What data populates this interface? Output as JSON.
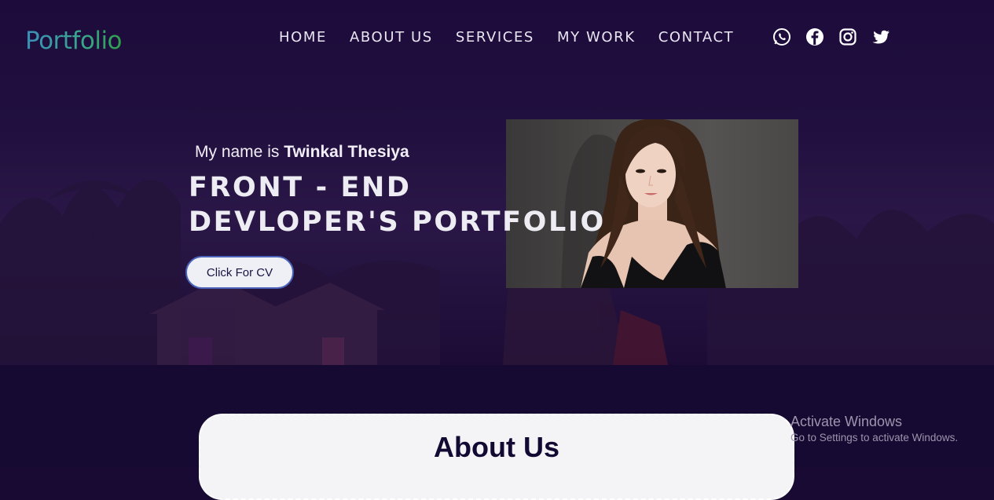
{
  "header": {
    "logo": "Portfolio",
    "nav": [
      "HOME",
      "ABOUT US",
      "SERVICES",
      "MY WORK",
      "CONTACT"
    ],
    "social_icons": [
      "whatsapp-icon",
      "facebook-icon",
      "instagram-icon",
      "twitter-icon"
    ]
  },
  "hero": {
    "intro_prefix": "My name is",
    "name": "Twinkal Thesiya",
    "headline": "FRONT - END DEVLOPER'S PORTFOLIO",
    "cv_button": "Click For CV",
    "photo": "portrait-photo"
  },
  "about": {
    "title": "About Us"
  },
  "watermark": {
    "line1": "Activate Windows",
    "line2": "Go to Settings to activate Windows."
  },
  "colors": {
    "background": "#180a33",
    "nav_text": "#e9e6f2",
    "button_border": "#4a63b8",
    "card": "#f4f4f6"
  }
}
